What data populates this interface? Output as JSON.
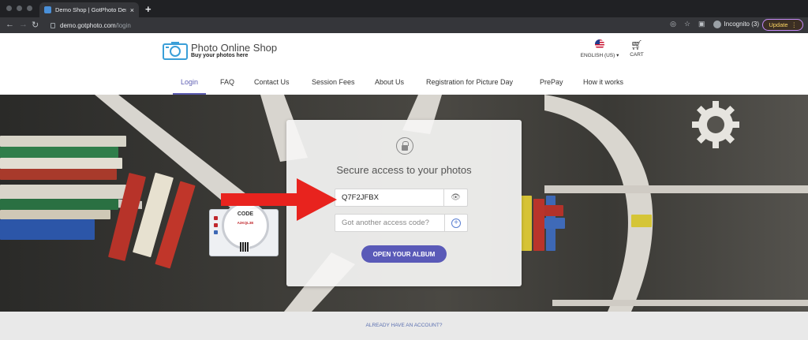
{
  "browser": {
    "tab_title": "Demo Shop | GotPhoto Demo S",
    "tab_close": "×",
    "new_tab": "+",
    "url_host": "demo.gotphoto.com",
    "url_path": "/login",
    "incognito_label": "Incognito (3)",
    "update_label": "Update"
  },
  "header": {
    "logo_title": "Photo Online Shop",
    "logo_tagline": "Buy your photos here",
    "language_label": "ENGLISH (US) ▾",
    "cart_label": "CART"
  },
  "nav": {
    "items": [
      {
        "label": "Login",
        "active": true
      },
      {
        "label": "FAQ"
      },
      {
        "label": "Contact Us"
      },
      {
        "label": "Session Fees"
      },
      {
        "label": "About Us"
      },
      {
        "label": "Registration for Picture Day"
      },
      {
        "label": "PrePay"
      },
      {
        "label": "How it works"
      }
    ]
  },
  "login": {
    "heading": "Secure access to your photos",
    "access_code_value": "Q7F2JFBX",
    "another_code_placeholder": "Got another access code?",
    "open_button": "OPEN YOUR ALBUM"
  },
  "illustration": {
    "code_label": "CODE",
    "code_value": "A2KQL3E"
  },
  "footer": {
    "account_link": "ALREADY HAVE AN ACCOUNT?"
  },
  "colors": {
    "accent": "#5a5ab8",
    "arrow": "#e8231e",
    "nav_active": "#5f5fb4"
  }
}
